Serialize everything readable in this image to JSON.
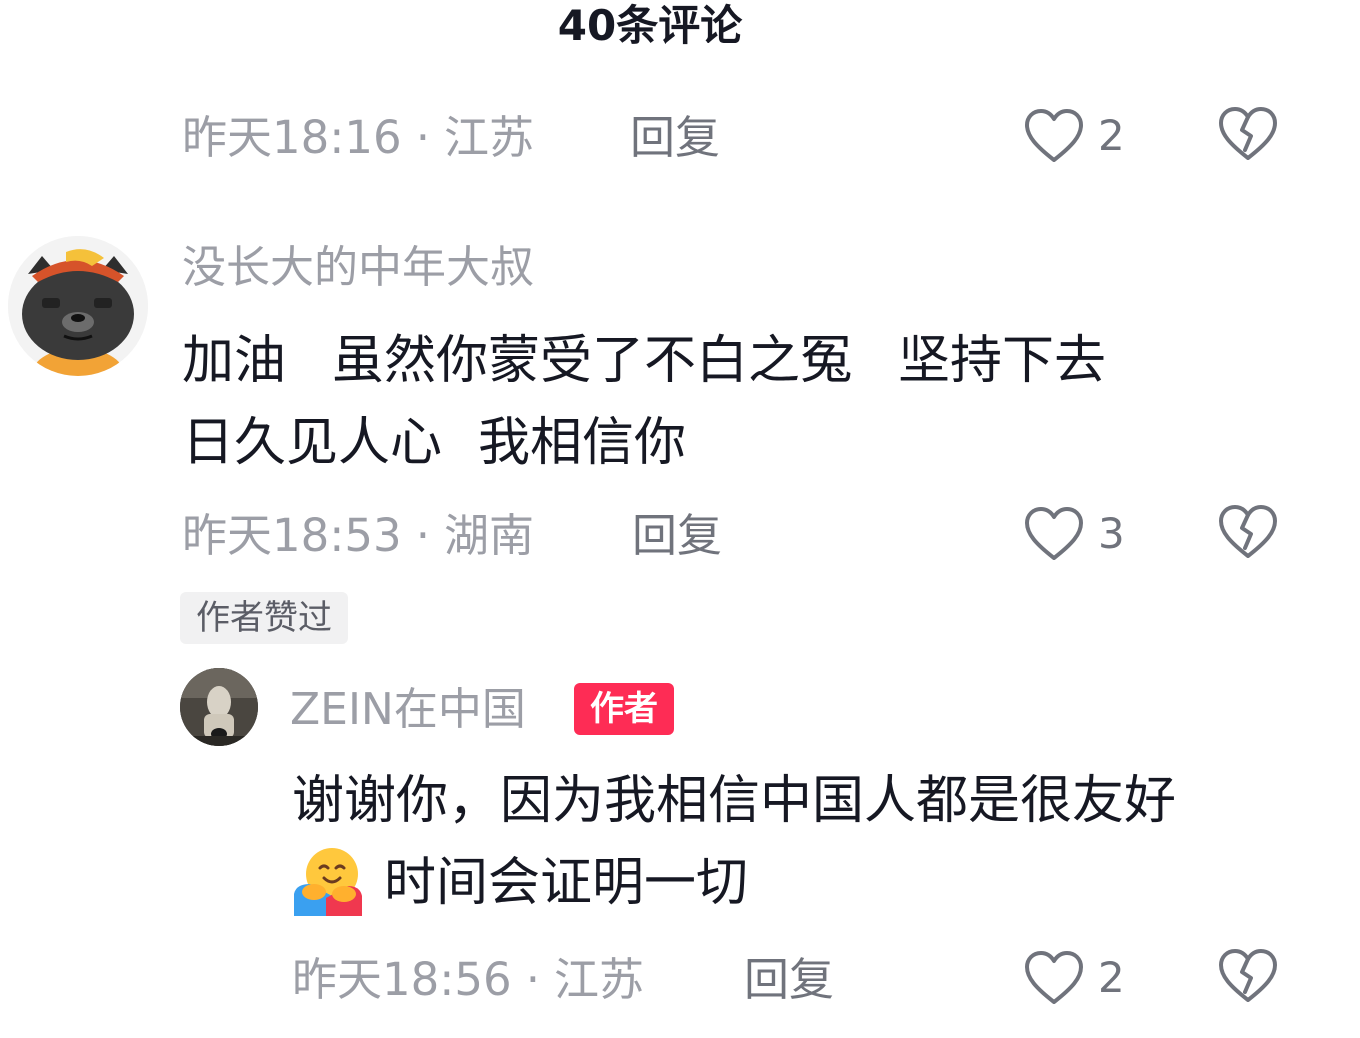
{
  "header": {
    "title": "40条评论"
  },
  "comment_prev": {
    "meta": "昨天18:16",
    "location": "江苏",
    "reply_label": "回复",
    "like_count": "2"
  },
  "comment1": {
    "username": "没长大的中年大叔",
    "line1_a": "加油",
    "line1_b": "虽然你蒙受了不白之冤",
    "line1_c": "坚持下去",
    "line2_a": "日久见人心",
    "line2_b": "我相信你",
    "meta": "昨天18:53",
    "location": "湖南",
    "reply_label": "回复",
    "like_count": "3",
    "liked_badge": "作者赞过"
  },
  "comment2": {
    "username": "ZEIN在中国",
    "author_badge": "作者",
    "line1": "谢谢你，因为我相信中国人都是很友好",
    "line2": "时间会证明一切",
    "emoji": "hugging-face-emoji",
    "meta": "昨天18:56",
    "location": "江苏",
    "reply_label": "回复",
    "like_count": "2"
  },
  "separator": "·",
  "icons": {
    "like": "heart-outline-icon",
    "dislike": "broken-heart-icon"
  },
  "colors": {
    "author_badge": "#fe2c55",
    "meta_text": "#9c9ea6",
    "body_text": "#161823"
  }
}
